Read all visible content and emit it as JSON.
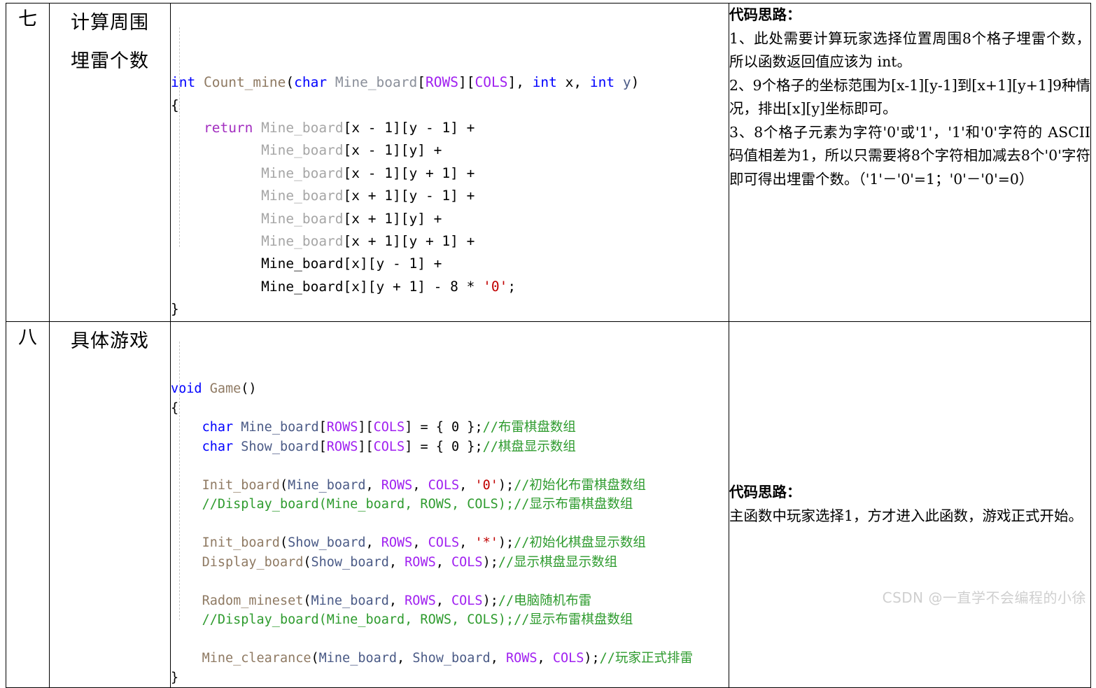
{
  "table": {
    "rows": [
      {
        "number": "七",
        "name_lines": [
          "计算周围",
          "埋雷个数"
        ],
        "code": [
          [
            {
              "t": "int",
              "c": "kw"
            },
            {
              "t": " ",
              "c": "punct"
            },
            {
              "t": "Count_mine",
              "c": "fn"
            },
            {
              "t": "(",
              "c": "punct"
            },
            {
              "t": "char",
              "c": "kw"
            },
            {
              "t": " ",
              "c": "punct"
            },
            {
              "t": "Mine_board",
              "c": "var"
            },
            {
              "t": "[",
              "c": "punct"
            },
            {
              "t": "ROWS",
              "c": "macro"
            },
            {
              "t": "]",
              "c": "punct"
            },
            {
              "t": "[",
              "c": "punct"
            },
            {
              "t": "COLS",
              "c": "macro"
            },
            {
              "t": "]",
              "c": "punct"
            },
            {
              "t": ", ",
              "c": "punct"
            },
            {
              "t": "int",
              "c": "kw"
            },
            {
              "t": " x, ",
              "c": "punct"
            },
            {
              "t": "int",
              "c": "kw"
            },
            {
              "t": " ",
              "c": "punct"
            },
            {
              "t": "y",
              "c": "varb"
            },
            {
              "t": ")",
              "c": "punct"
            }
          ],
          [
            {
              "t": "{",
              "c": "punct"
            }
          ],
          [
            {
              "t": "    ",
              "c": "punct"
            },
            {
              "t": "return",
              "c": "ret"
            },
            {
              "t": " ",
              "c": "punct"
            },
            {
              "t": "Mine_board",
              "c": "dim"
            },
            {
              "t": "[x - 1][y - 1] +",
              "c": "punct"
            }
          ],
          [
            {
              "t": "           ",
              "c": "punct"
            },
            {
              "t": "Mine_board",
              "c": "dim"
            },
            {
              "t": "[x - 1][y] +",
              "c": "punct"
            }
          ],
          [
            {
              "t": "           ",
              "c": "punct"
            },
            {
              "t": "Mine_board",
              "c": "dim"
            },
            {
              "t": "[x - 1][y + 1] +",
              "c": "punct"
            }
          ],
          [
            {
              "t": "           ",
              "c": "punct"
            },
            {
              "t": "Mine_board",
              "c": "dim"
            },
            {
              "t": "[x + 1][y - 1] +",
              "c": "punct"
            }
          ],
          [
            {
              "t": "           ",
              "c": "punct"
            },
            {
              "t": "Mine_board",
              "c": "dim"
            },
            {
              "t": "[x + 1][y] +",
              "c": "punct"
            }
          ],
          [
            {
              "t": "           ",
              "c": "punct"
            },
            {
              "t": "Mine_board",
              "c": "dim"
            },
            {
              "t": "[x + 1][y + 1] +",
              "c": "punct"
            }
          ],
          [
            {
              "t": "           ",
              "c": "punct"
            },
            {
              "t": "Mine_board",
              "c": "punct"
            },
            {
              "t": "[x][y - 1] +",
              "c": "punct"
            }
          ],
          [
            {
              "t": "           ",
              "c": "punct"
            },
            {
              "t": "Mine_board",
              "c": "punct"
            },
            {
              "t": "[x][y + 1] - 8 * ",
              "c": "punct"
            },
            {
              "t": "'0'",
              "c": "char"
            },
            {
              "t": ";",
              "c": "punct"
            }
          ],
          [
            {
              "t": "}",
              "c": "punct"
            }
          ]
        ],
        "note": {
          "title": "代码思路：",
          "paragraphs": [
            "1、此处需要计算玩家选择位置周围8个格子埋雷个数，所以函数返回值应该为 int。",
            "2、9个格子的坐标范围为[x-1][y-1]到[x+1][y+1]9种情况，排出[x][y]坐标即可。",
            "3、8个格子元素为字符'0'或'1'，'1'和'0'字符的 ASCII 码值相差为1，所以只需要将8个字符相加减去8个'0'字符即可得出埋雷个数。（'1'－'0'=1；'0'－'0'=0）"
          ]
        }
      },
      {
        "number": "八",
        "name_lines": [
          "具体游戏"
        ],
        "code": [
          [
            {
              "t": "void",
              "c": "kw"
            },
            {
              "t": " ",
              "c": "punct"
            },
            {
              "t": "Game",
              "c": "fn"
            },
            {
              "t": "()",
              "c": "punct"
            }
          ],
          [
            {
              "t": "{",
              "c": "punct"
            }
          ],
          [
            {
              "t": "    ",
              "c": "punct"
            },
            {
              "t": "char",
              "c": "kw"
            },
            {
              "t": " ",
              "c": "punct"
            },
            {
              "t": "Mine_board",
              "c": "varb"
            },
            {
              "t": "[",
              "c": "punct"
            },
            {
              "t": "ROWS",
              "c": "macro"
            },
            {
              "t": "][",
              "c": "punct"
            },
            {
              "t": "COLS",
              "c": "macro"
            },
            {
              "t": "] = { 0 };",
              "c": "punct"
            },
            {
              "t": "//布雷棋盘数组",
              "c": "cmt"
            }
          ],
          [
            {
              "t": "    ",
              "c": "punct"
            },
            {
              "t": "char",
              "c": "kw"
            },
            {
              "t": " ",
              "c": "punct"
            },
            {
              "t": "Show_board",
              "c": "varb"
            },
            {
              "t": "[",
              "c": "punct"
            },
            {
              "t": "ROWS",
              "c": "macro"
            },
            {
              "t": "][",
              "c": "punct"
            },
            {
              "t": "COLS",
              "c": "macro"
            },
            {
              "t": "] = { 0 };",
              "c": "punct"
            },
            {
              "t": "//棋盘显示数组",
              "c": "cmt"
            }
          ],
          [
            {
              "t": "",
              "c": "punct"
            }
          ],
          [
            {
              "t": "    ",
              "c": "punct"
            },
            {
              "t": "Init_board",
              "c": "fn"
            },
            {
              "t": "(",
              "c": "punct"
            },
            {
              "t": "Mine_board",
              "c": "varb"
            },
            {
              "t": ", ",
              "c": "punct"
            },
            {
              "t": "ROWS",
              "c": "macro"
            },
            {
              "t": ", ",
              "c": "punct"
            },
            {
              "t": "COLS",
              "c": "macro"
            },
            {
              "t": ", ",
              "c": "punct"
            },
            {
              "t": "'0'",
              "c": "char"
            },
            {
              "t": ");",
              "c": "punct"
            },
            {
              "t": "//初始化布雷棋盘数组",
              "c": "cmt"
            }
          ],
          [
            {
              "t": "    ",
              "c": "punct"
            },
            {
              "t": "//Display_board(Mine_board, ROWS, COLS);//显示布雷棋盘数组",
              "c": "cmt"
            }
          ],
          [
            {
              "t": "",
              "c": "punct"
            }
          ],
          [
            {
              "t": "    ",
              "c": "punct"
            },
            {
              "t": "Init_board",
              "c": "fn"
            },
            {
              "t": "(",
              "c": "punct"
            },
            {
              "t": "Show_board",
              "c": "varb"
            },
            {
              "t": ", ",
              "c": "punct"
            },
            {
              "t": "ROWS",
              "c": "macro"
            },
            {
              "t": ", ",
              "c": "punct"
            },
            {
              "t": "COLS",
              "c": "macro"
            },
            {
              "t": ", ",
              "c": "punct"
            },
            {
              "t": "'*'",
              "c": "char"
            },
            {
              "t": ");",
              "c": "punct"
            },
            {
              "t": "//初始化棋盘显示数组",
              "c": "cmt"
            }
          ],
          [
            {
              "t": "    ",
              "c": "punct"
            },
            {
              "t": "Display_board",
              "c": "fn"
            },
            {
              "t": "(",
              "c": "punct"
            },
            {
              "t": "Show_board",
              "c": "varb"
            },
            {
              "t": ", ",
              "c": "punct"
            },
            {
              "t": "ROWS",
              "c": "macro"
            },
            {
              "t": ", ",
              "c": "punct"
            },
            {
              "t": "COLS",
              "c": "macro"
            },
            {
              "t": ");",
              "c": "punct"
            },
            {
              "t": "//显示棋盘显示数组",
              "c": "cmt"
            }
          ],
          [
            {
              "t": "",
              "c": "punct"
            }
          ],
          [
            {
              "t": "    ",
              "c": "punct"
            },
            {
              "t": "Radom_mineset",
              "c": "fn"
            },
            {
              "t": "(",
              "c": "punct"
            },
            {
              "t": "Mine_board",
              "c": "varb"
            },
            {
              "t": ", ",
              "c": "punct"
            },
            {
              "t": "ROWS",
              "c": "macro"
            },
            {
              "t": ", ",
              "c": "punct"
            },
            {
              "t": "COLS",
              "c": "macro"
            },
            {
              "t": ");",
              "c": "punct"
            },
            {
              "t": "//电脑随机布雷",
              "c": "cmt"
            }
          ],
          [
            {
              "t": "    ",
              "c": "punct"
            },
            {
              "t": "//Display_board(Mine_board, ROWS, COLS);//显示布雷棋盘数组",
              "c": "cmt"
            }
          ],
          [
            {
              "t": "",
              "c": "punct"
            }
          ],
          [
            {
              "t": "    ",
              "c": "punct"
            },
            {
              "t": "Mine_clearance",
              "c": "fn"
            },
            {
              "t": "(",
              "c": "punct"
            },
            {
              "t": "Mine_board",
              "c": "varb"
            },
            {
              "t": ", ",
              "c": "punct"
            },
            {
              "t": "Show_board",
              "c": "varb"
            },
            {
              "t": ", ",
              "c": "punct"
            },
            {
              "t": "ROWS",
              "c": "macro"
            },
            {
              "t": ", ",
              "c": "punct"
            },
            {
              "t": "COLS",
              "c": "macro"
            },
            {
              "t": ");",
              "c": "punct"
            },
            {
              "t": "//玩家正式排雷",
              "c": "cmt"
            }
          ],
          [
            {
              "t": "}",
              "c": "punct"
            }
          ]
        ],
        "note": {
          "title": "代码思路：",
          "paragraphs": [
            "主函数中玩家选择1，方才进入此函数，游戏正式开始。"
          ]
        }
      }
    ]
  },
  "watermark": "CSDN @一直学不会编程的小徐",
  "colors": {
    "keyword": "#0000ff",
    "return_keyword": "#a32fc0",
    "function": "#8f7a63",
    "variable_dim": "#a6a6a6",
    "variable": "#4a5a86",
    "macro": "#a020f0",
    "char_literal": "#c00000",
    "comment": "#2e9b2e",
    "border": "#000000",
    "watermark": "#cfcfcf"
  }
}
